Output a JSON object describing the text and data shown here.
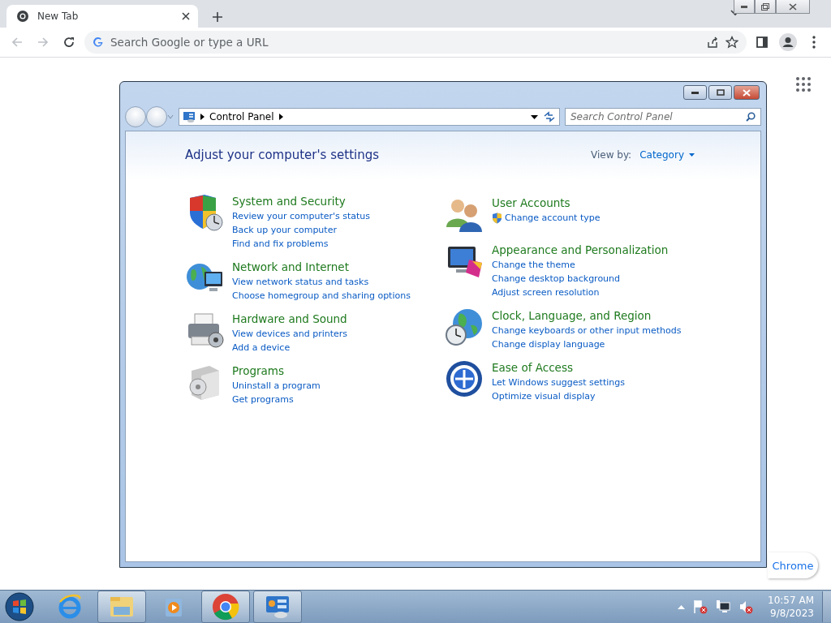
{
  "browser": {
    "tab": {
      "title": "New Tab"
    },
    "omnibox": {
      "placeholder": "Search Google or type a URL"
    },
    "customize_button": {
      "label": "Chrome"
    }
  },
  "control_panel": {
    "breadcrumb": [
      "Control Panel"
    ],
    "search": {
      "placeholder": "Search Control Panel"
    },
    "heading": "Adjust your computer's settings",
    "view_by": {
      "label": "View by:",
      "value": "Category"
    },
    "columns": [
      [
        {
          "kind": "security",
          "title": "System and Security",
          "links": [
            {
              "text": "Review your computer's status",
              "shield": false
            },
            {
              "text": "Back up your computer",
              "shield": false
            },
            {
              "text": "Find and fix problems",
              "shield": false
            }
          ]
        },
        {
          "kind": "network",
          "title": "Network and Internet",
          "links": [
            {
              "text": "View network status and tasks",
              "shield": false
            },
            {
              "text": "Choose homegroup and sharing options",
              "shield": false
            }
          ]
        },
        {
          "kind": "hardware",
          "title": "Hardware and Sound",
          "links": [
            {
              "text": "View devices and printers",
              "shield": false
            },
            {
              "text": "Add a device",
              "shield": false
            }
          ]
        },
        {
          "kind": "programs",
          "title": "Programs",
          "links": [
            {
              "text": "Uninstall a program",
              "shield": false
            },
            {
              "text": "Get programs",
              "shield": false
            }
          ]
        }
      ],
      [
        {
          "kind": "users",
          "title": "User Accounts",
          "links": [
            {
              "text": "Change account type",
              "shield": true
            }
          ]
        },
        {
          "kind": "appearance",
          "title": "Appearance and Personalization",
          "links": [
            {
              "text": "Change the theme",
              "shield": false
            },
            {
              "text": "Change desktop background",
              "shield": false
            },
            {
              "text": "Adjust screen resolution",
              "shield": false
            }
          ]
        },
        {
          "kind": "clock",
          "title": "Clock, Language, and Region",
          "links": [
            {
              "text": "Change keyboards or other input methods",
              "shield": false
            },
            {
              "text": "Change display language",
              "shield": false
            }
          ]
        },
        {
          "kind": "access",
          "title": "Ease of Access",
          "links": [
            {
              "text": "Let Windows suggest settings",
              "shield": false
            },
            {
              "text": "Optimize visual display",
              "shield": false
            }
          ]
        }
      ]
    ]
  },
  "taskbar": {
    "apps": [
      {
        "kind": "ie",
        "running": false
      },
      {
        "kind": "explorer",
        "running": true
      },
      {
        "kind": "media",
        "running": false
      },
      {
        "kind": "chrome",
        "running": true
      },
      {
        "kind": "control",
        "running": true
      }
    ],
    "clock": {
      "time": "10:57 AM",
      "date": "9/8/2023"
    }
  }
}
